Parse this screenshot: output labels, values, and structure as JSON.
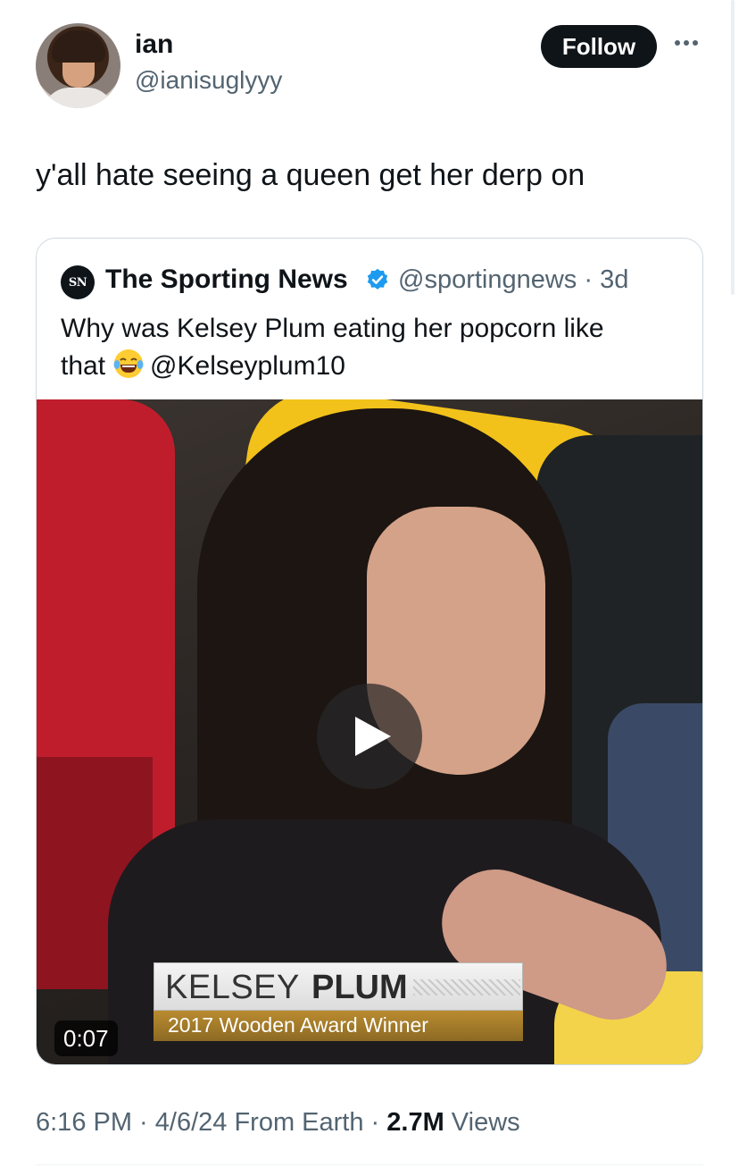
{
  "author": {
    "display_name": "ian",
    "handle": "@ianisuglyyy",
    "avatar": "profile-photo"
  },
  "actions": {
    "follow_label": "Follow",
    "more_icon": "more-horizontal-icon"
  },
  "tweet": {
    "text": "y'all hate seeing a queen get her derp on"
  },
  "quote": {
    "logo_text": "SN",
    "name": "The Sporting News",
    "verified_icon": "verified-badge-icon",
    "verified_color": "#1d9bf0",
    "handle_time": "@sportingnews · 3d",
    "text_line1": "Why was Kelsey Plum eating her popcorn like",
    "text_line2_before": "that",
    "emoji": "face-with-tears-of-joy-emoji",
    "text_line2_after": "@Kelseyplum10",
    "video": {
      "duration": "0:07",
      "play_icon": "play-icon",
      "lower_third_first": "KELSEY",
      "lower_third_last": "PLUM",
      "lower_third_sub": "2017 Wooden Award Winner"
    }
  },
  "meta": {
    "time_date": "6:16 PM · 4/6/24 From Earth · ",
    "views_count": "2.7M",
    "views_label": " Views"
  }
}
